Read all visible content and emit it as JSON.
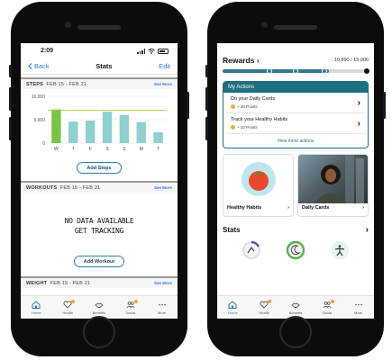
{
  "left_phone": {
    "status": {
      "time": "2:09"
    },
    "nav": {
      "back": "Back",
      "title": "Stats",
      "edit": "Edit"
    },
    "steps": {
      "label": "STEPS",
      "range": "FEB 15 - FEB 21",
      "see_more": "See More",
      "button": "Add Steps"
    },
    "workouts": {
      "label": "WORKOUTS",
      "range": "FEB 15 - FEB 21",
      "see_more": "See More",
      "empty_line1": "NO DATA AVAILABLE",
      "empty_line2": "GET TRACKING",
      "button": "Add Workout"
    },
    "weight": {
      "label": "WEIGHT",
      "range": "FEB 15 - FEB 21",
      "see_more": "See More"
    },
    "tabs": [
      {
        "label": "Home",
        "icon": "home-icon"
      },
      {
        "label": "Health",
        "icon": "heart-icon"
      },
      {
        "label": "Benefits",
        "icon": "handshake-icon"
      },
      {
        "label": "Social",
        "icon": "people-icon"
      },
      {
        "label": "More",
        "icon": "more-icon"
      }
    ]
  },
  "chart_data": {
    "type": "bar",
    "categories": [
      "W",
      "T",
      "F",
      "S",
      "S",
      "M",
      "T"
    ],
    "values": [
      7200,
      4600,
      4800,
      6700,
      6000,
      4500,
      2300
    ],
    "highlight_index": 0,
    "ylim": [
      0,
      10000
    ],
    "yticks": [
      "10,000",
      "5,000",
      "0"
    ],
    "goal_line": 7000,
    "colors": {
      "highlight": "#7cc24a",
      "bar": "#8fcfcf",
      "goal": "#9fd45a"
    }
  },
  "right_phone": {
    "rewards": {
      "title": "Rewards",
      "points": "10,890 / 15,000",
      "progress": 0.726
    },
    "actions": {
      "header": "My Actions",
      "items": [
        {
          "title": "Do your Daily Cards",
          "points": "+ 20 Points"
        },
        {
          "title": "Track your Healthy Habits",
          "points": "+ 10 Points"
        }
      ],
      "view_more": "View more actions"
    },
    "cards": [
      {
        "label": "Healthy Habits"
      },
      {
        "label": "Daily Cards"
      }
    ],
    "stats_title": "Stats",
    "tabs": [
      {
        "label": "Home",
        "icon": "home-icon"
      },
      {
        "label": "Health",
        "icon": "heart-icon"
      },
      {
        "label": "Benefits",
        "icon": "handshake-icon"
      },
      {
        "label": "Social",
        "icon": "people-icon"
      },
      {
        "label": "More",
        "icon": "more-icon"
      }
    ]
  },
  "colors": {
    "accent_blue": "#2d7cd6",
    "teal": "#1f6e81",
    "orange_dot": "#f2a33a"
  }
}
